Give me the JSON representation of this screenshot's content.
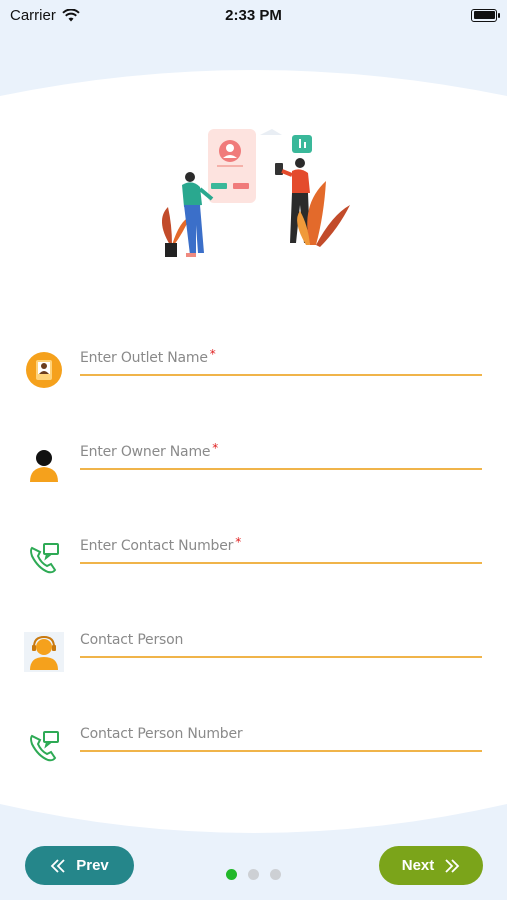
{
  "status_bar": {
    "carrier": "Carrier",
    "time": "2:33 PM"
  },
  "form": {
    "fields": [
      {
        "placeholder": "Enter Outlet Name",
        "required": "*",
        "icon": "store-icon"
      },
      {
        "placeholder": "Enter Owner Name",
        "required": "*",
        "icon": "user-icon"
      },
      {
        "placeholder": "Enter Contact Number",
        "required": "*",
        "icon": "phone-chat-icon"
      },
      {
        "placeholder": "Contact Person",
        "required": "",
        "icon": "support-agent-icon"
      },
      {
        "placeholder": "Contact Person Number",
        "required": "",
        "icon": "phone-chat-icon"
      }
    ]
  },
  "nav": {
    "prev_label": "Prev",
    "next_label": "Next",
    "pages": 3,
    "active_page": 1
  },
  "colors": {
    "accent_line": "#f0b44a",
    "prev_button": "#25868a",
    "next_button": "#7ba41a",
    "active_dot": "#21b82a"
  }
}
